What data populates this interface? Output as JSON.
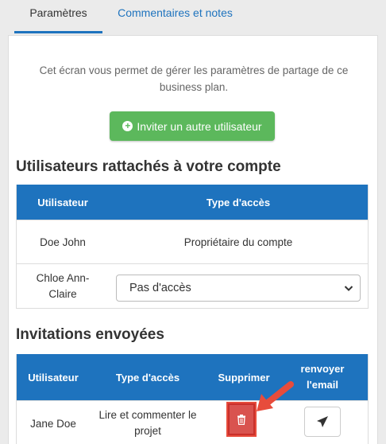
{
  "tabs": [
    {
      "label": "Paramètres",
      "active": true
    },
    {
      "label": "Commentaires et notes",
      "active": false
    }
  ],
  "intro_text": "Cet écran vous permet de gérer les paramètres de partage de ce business plan.",
  "invite_button": {
    "label": "Inviter un autre utilisateur",
    "icon": "plus-circle-icon"
  },
  "users_section": {
    "title": "Utilisateurs rattachés à votre compte",
    "headers": [
      "Utilisateur",
      "Type d'accès"
    ],
    "rows": [
      {
        "user": "Doe John",
        "access": "Propriétaire du compte"
      },
      {
        "user": "Chloe Ann-Claire",
        "access_select": "Pas d'accès"
      }
    ]
  },
  "invitations_section": {
    "title": "Invitations envoyées",
    "headers": [
      "Utilisateur",
      "Type d'accès",
      "Supprimer",
      "renvoyer l'email"
    ],
    "rows": [
      {
        "user": "Jane Doe",
        "access": "Lire et commenter le projet",
        "delete_icon": "trash-icon",
        "resend_icon": "paper-plane-icon"
      }
    ]
  },
  "colors": {
    "primary": "#1e73be",
    "success": "#5cb85c",
    "danger": "#d9534f",
    "annotation": "#e74c3c"
  }
}
